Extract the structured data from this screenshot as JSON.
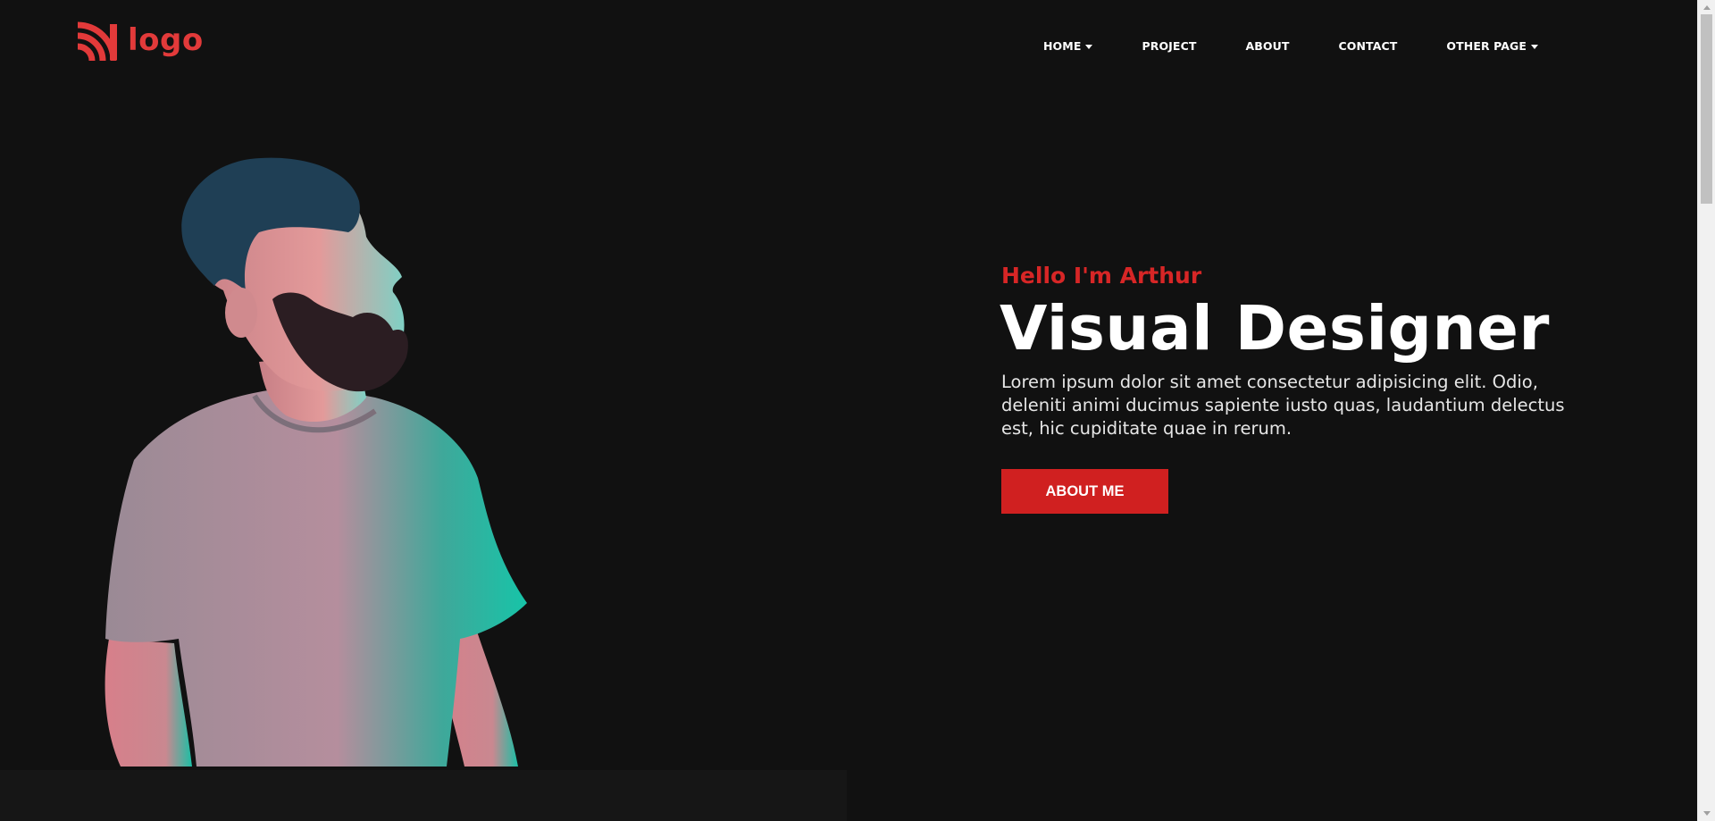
{
  "header": {
    "logo_text": "logo",
    "nav": [
      {
        "label": "HOME",
        "has_dropdown": true
      },
      {
        "label": "PROJECT",
        "has_dropdown": false
      },
      {
        "label": "ABOUT",
        "has_dropdown": false
      },
      {
        "label": "CONTACT",
        "has_dropdown": false
      },
      {
        "label": "OTHER PAGE",
        "has_dropdown": true
      }
    ]
  },
  "hero": {
    "greeting": "Hello I'm Arthur",
    "title": "Visual Designer",
    "description": "Lorem ipsum dolor sit amet consectetur adipisicing elit. Odio, deleniti animi ducimus sapiente iusto quas, laudantium delectus est, hic cupiditate quae in rerum.",
    "button_label": "ABOUT ME"
  },
  "colors": {
    "background": "#111111",
    "accent": "#d02020",
    "logo": "#e23a3a",
    "text": "#ffffff"
  },
  "icons": {
    "logo_mark": "rss-feed-icon",
    "dropdown": "caret-down-icon"
  }
}
